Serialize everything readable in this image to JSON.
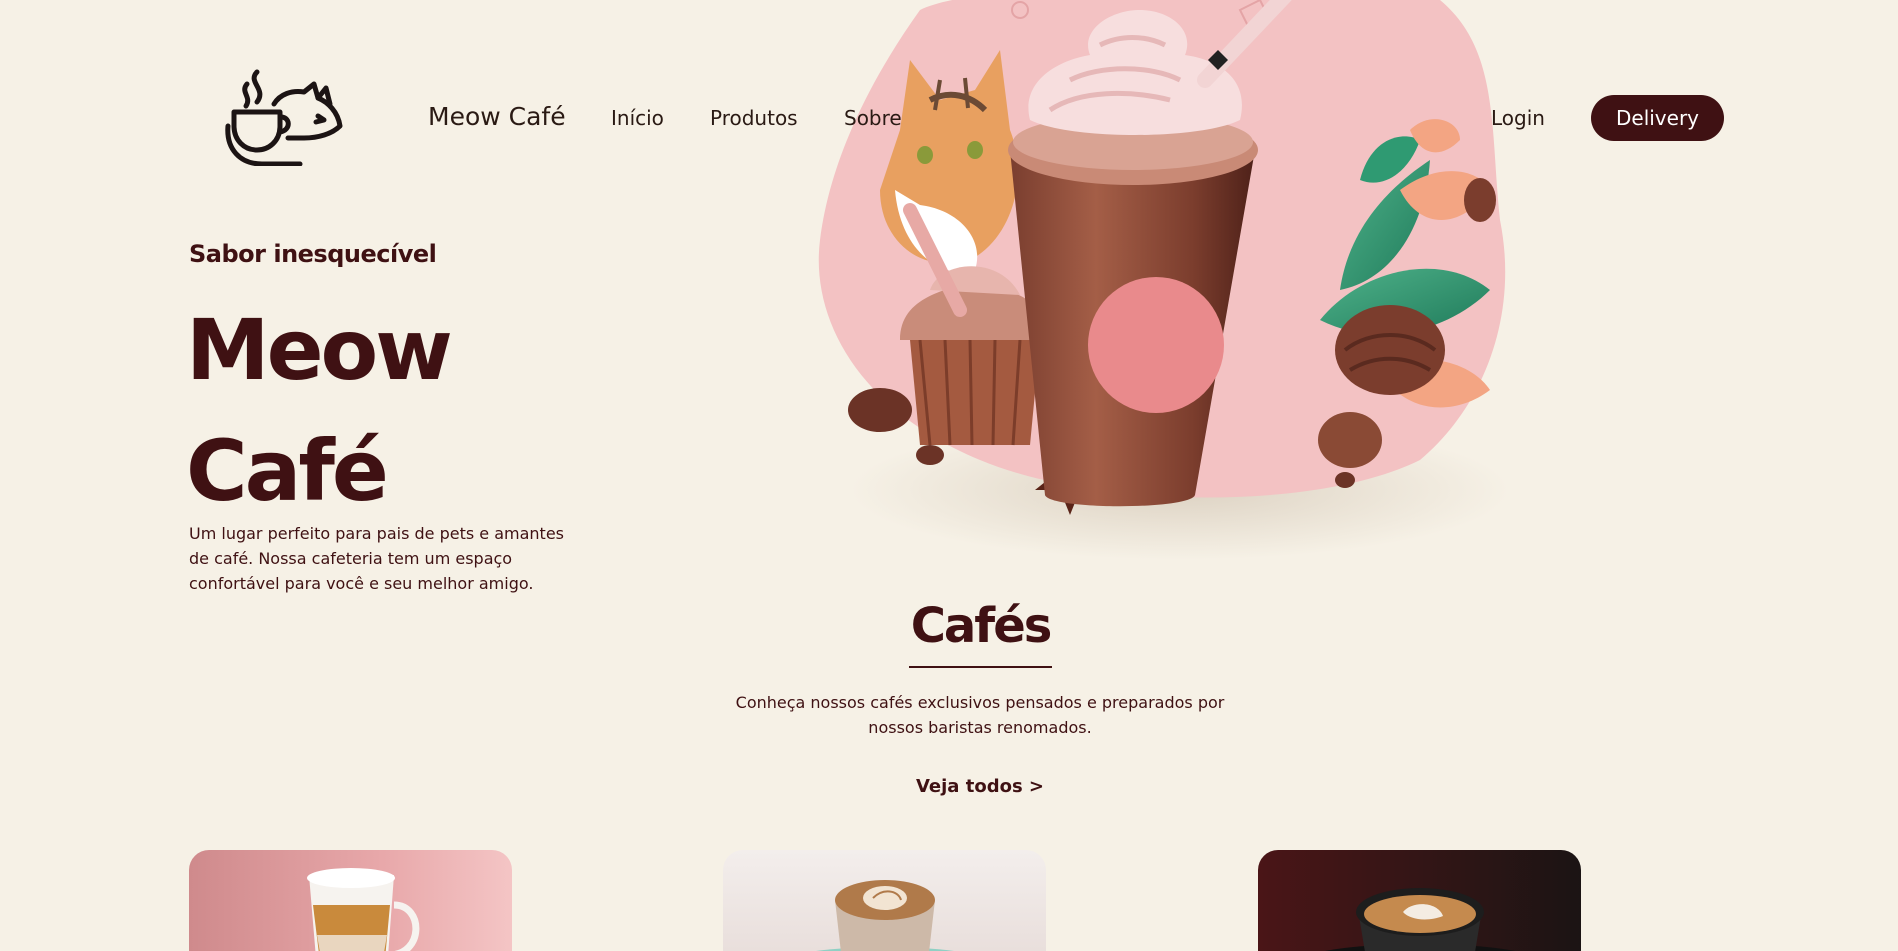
{
  "header": {
    "logo_icon": "cat-coffee-cup-logo-icon",
    "brand": "Meow Café",
    "nav": [
      {
        "label": "Início"
      },
      {
        "label": "Produtos"
      },
      {
        "label": "Sobre"
      }
    ],
    "login_label": "Login",
    "delivery_label": "Delivery"
  },
  "hero": {
    "tagline": "Sabor inesquecível",
    "title_line1": "Meow",
    "title_line2": "Café",
    "description": "Um lugar perfeito para pais de pets e amantes de café. Nossa cafeteria tem um espaço confortável para você e seu melhor amigo.",
    "image_icon": "iced-coffee-cat-illustration"
  },
  "coffees": {
    "title": "Cafés",
    "description": "Conheça nossos cafés exclusivos pensados e preparados por nossos baristas renomados.",
    "see_all_label": "Veja todos >",
    "cards": [
      {
        "icon": "latte-macchiato-glass-icon"
      },
      {
        "icon": "cappuccino-latte-art-icon"
      },
      {
        "icon": "black-cup-latte-art-icon"
      }
    ]
  },
  "colors": {
    "background": "#f6f1e6",
    "primary": "#3f1113",
    "accent_pink": "#f2bcbd",
    "dot_pink": "#e98a8c"
  }
}
